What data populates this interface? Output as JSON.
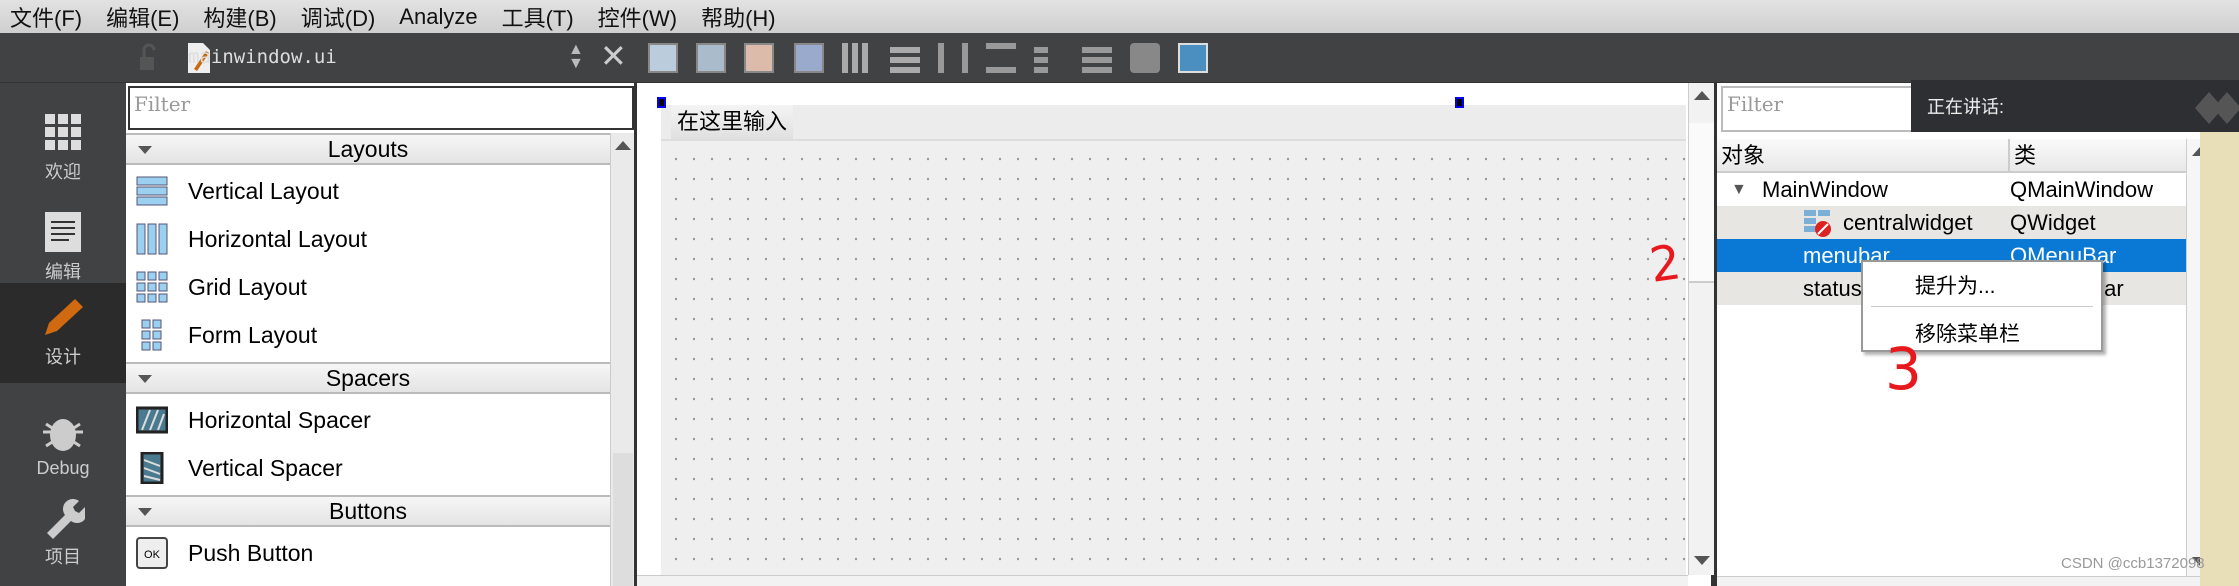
{
  "menubar": [
    "文件(F)",
    "编辑(E)",
    "构建(B)",
    "调试(D)",
    "Analyze",
    "工具(T)",
    "控件(W)",
    "帮助(H)"
  ],
  "editor": {
    "filename": "mainwindow.ui"
  },
  "modes": [
    {
      "label": "欢迎",
      "icon": "grid-icon"
    },
    {
      "label": "编辑",
      "icon": "document-icon"
    },
    {
      "label": "设计",
      "icon": "pencil-icon",
      "active": true
    },
    {
      "label": "Debug",
      "icon": "bug-icon"
    },
    {
      "label": "项目",
      "icon": "wrench-icon"
    }
  ],
  "widgetbox": {
    "filter_placeholder": "Filter",
    "categories": [
      {
        "name": "Layouts",
        "items": [
          "Vertical Layout",
          "Horizontal Layout",
          "Grid Layout",
          "Form Layout"
        ]
      },
      {
        "name": "Spacers",
        "items": [
          "Horizontal Spacer",
          "Vertical Spacer"
        ]
      },
      {
        "name": "Buttons",
        "items": [
          "Push Button"
        ]
      }
    ]
  },
  "form": {
    "menu_placeholder": "在这里输入"
  },
  "object_inspector": {
    "filter_placeholder": "Filter",
    "columns": [
      "对象",
      "类"
    ],
    "rows": [
      {
        "object": "MainWindow",
        "class": "QMainWindow"
      },
      {
        "object": "centralwidget",
        "class": "QWidget"
      },
      {
        "object": "menubar",
        "class": "QMenuBar",
        "selected": true
      },
      {
        "object": "statusbar",
        "class": "QStatusBar"
      }
    ]
  },
  "context_menu": [
    "提升为...",
    "移除菜单栏"
  ],
  "overlay": {
    "speaking_label": "正在讲话:"
  },
  "annotations": [
    "2",
    "3"
  ],
  "watermark": "CSDN @ccb1372098",
  "colors": {
    "selection": "#0a79d5",
    "dark_panel": "#404244",
    "annotation": "#e8191c"
  }
}
